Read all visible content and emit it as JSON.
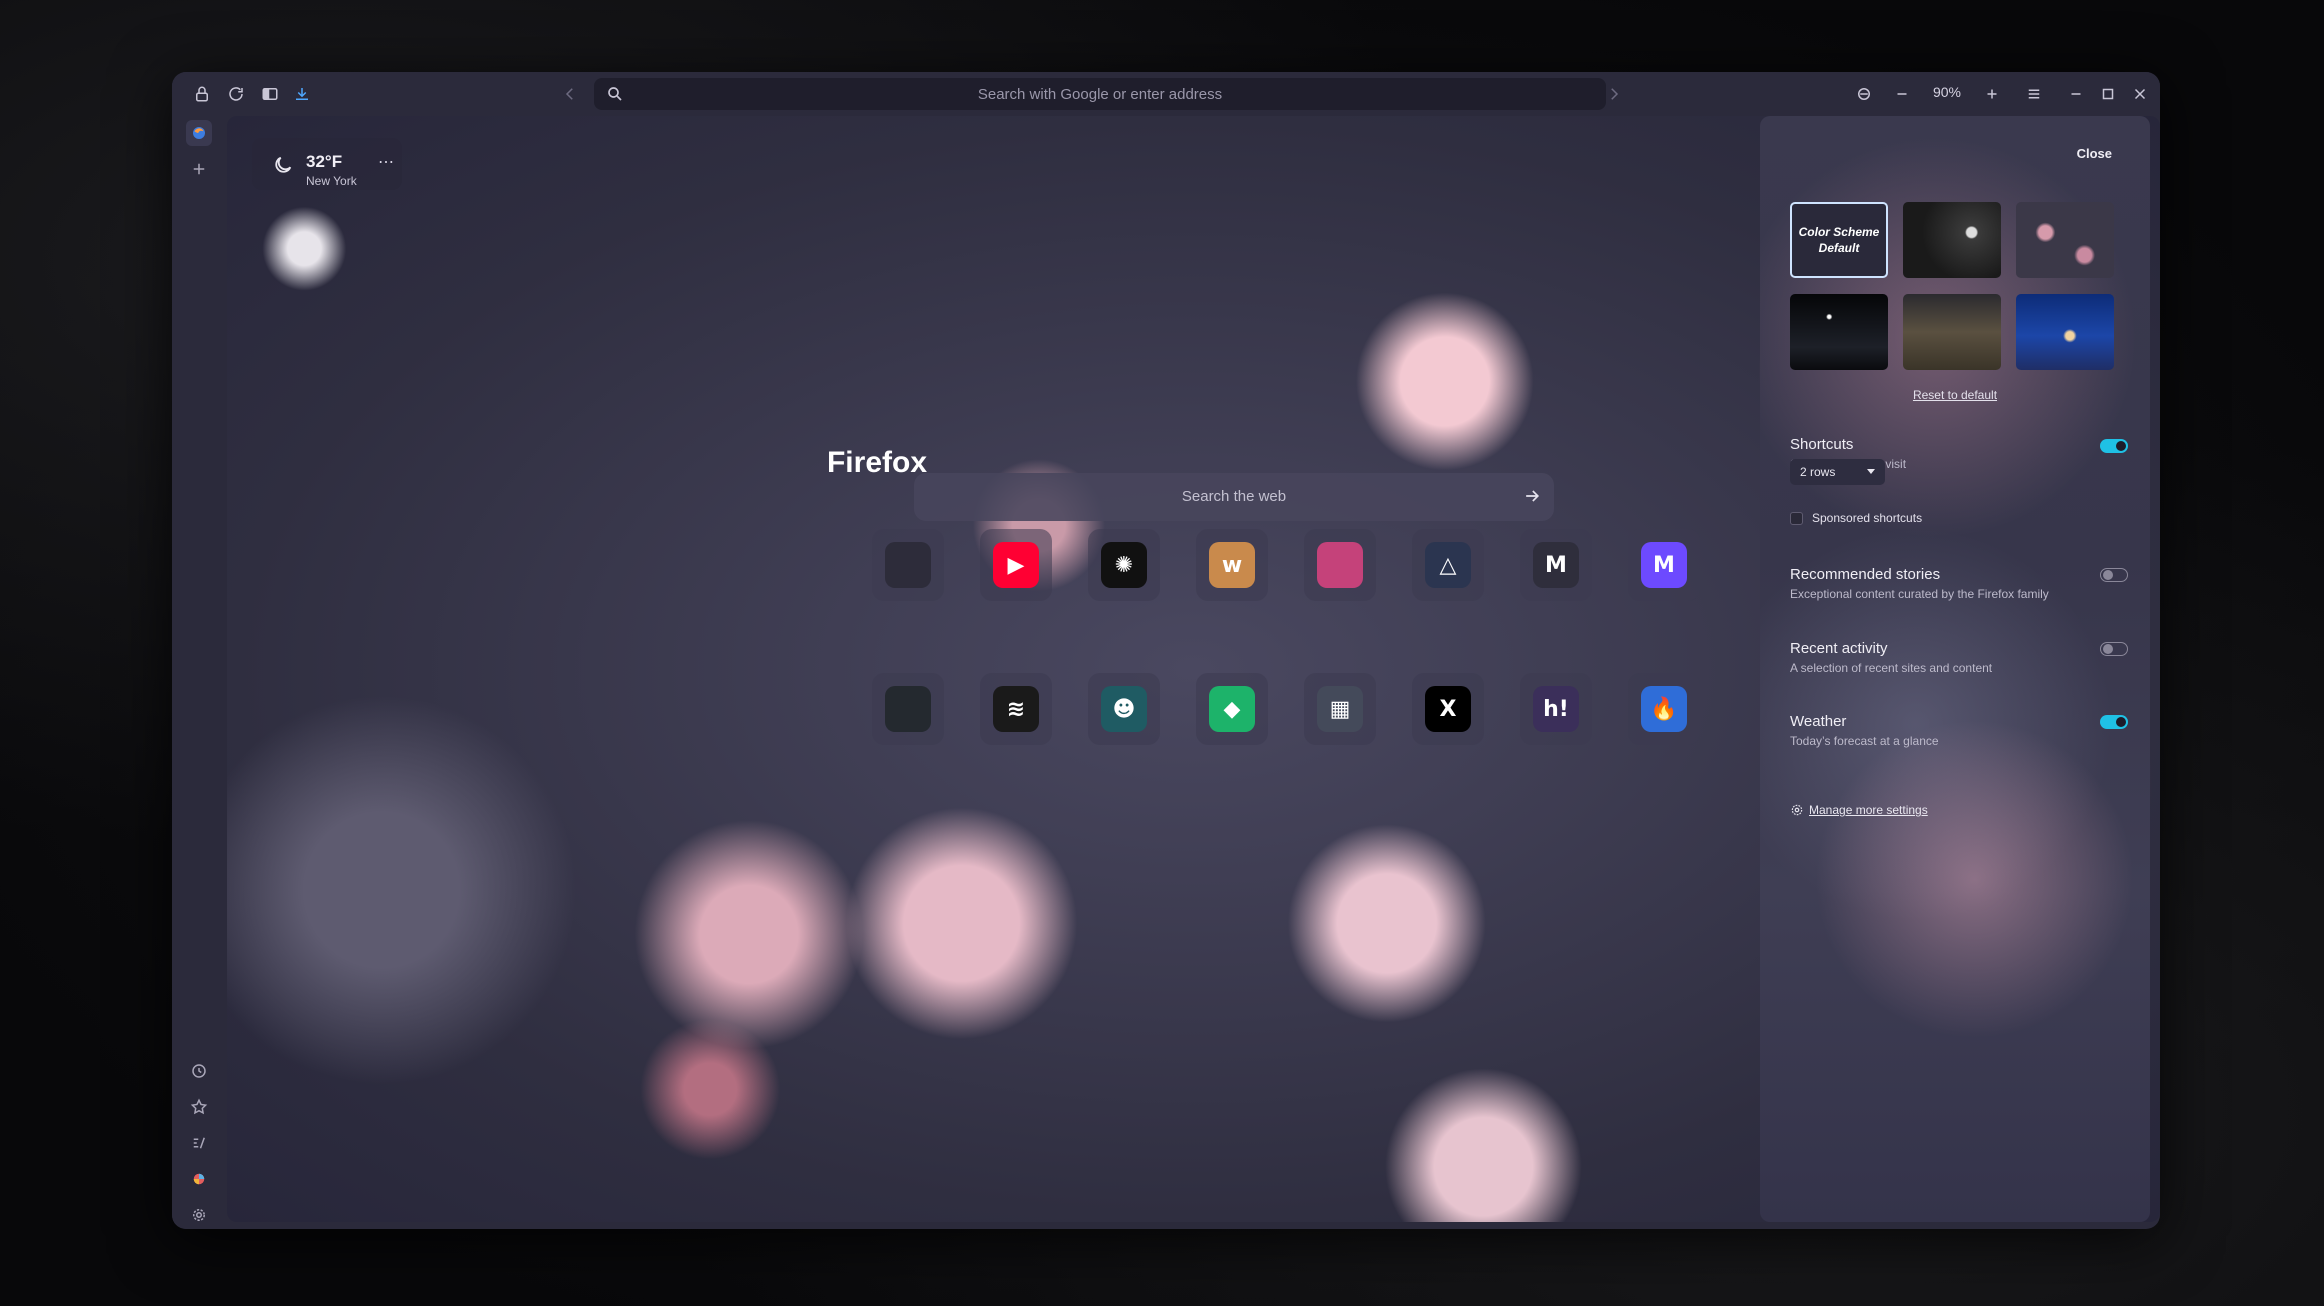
{
  "toolbar": {
    "url_placeholder": "Search with Google or enter address",
    "zoom": "90%"
  },
  "weather": {
    "temperature": "32°F",
    "location": "New York",
    "menu": "⋯"
  },
  "newtab": {
    "brand": "Firefox",
    "search_placeholder": "Search the web"
  },
  "shortcuts": [
    {
      "icon": "github-icon",
      "glyph": "",
      "bg": "#2d2c3a"
    },
    {
      "icon": "youtube-icon",
      "glyph": "▶",
      "bg": "#ff0033"
    },
    {
      "icon": "chatgpt-icon",
      "glyph": "✺",
      "bg": "#111111"
    },
    {
      "icon": "wordtune-icon",
      "glyph": "w",
      "bg": "#c98a4c"
    },
    {
      "icon": "pink-gradient-icon",
      "glyph": "",
      "bg": "#c5427a"
    },
    {
      "icon": "mountain-icon",
      "glyph": "△",
      "bg": "#2b3550"
    },
    {
      "icon": "gmail-icon",
      "glyph": "M",
      "bg": "#2f2e3c"
    },
    {
      "icon": "proton-mail-icon",
      "glyph": "M",
      "bg": "#6d4aff"
    },
    {
      "icon": "github-icon",
      "glyph": "",
      "bg": "#24292f"
    },
    {
      "icon": "spotify-icon",
      "glyph": "≋",
      "bg": "#1a1a1a"
    },
    {
      "icon": "green-mascot-icon",
      "glyph": "☻",
      "bg": "#1f5b63"
    },
    {
      "icon": "tag-icon",
      "glyph": "◆",
      "bg": "#1db36a"
    },
    {
      "icon": "server-icon",
      "glyph": "▦",
      "bg": "#444a5a"
    },
    {
      "icon": "x-icon",
      "glyph": "X",
      "bg": "#000000"
    },
    {
      "icon": "hashnode-icon",
      "glyph": "h!",
      "bg": "#3b2f5a"
    },
    {
      "icon": "flame-icon",
      "glyph": "🔥",
      "bg": "#2f6dd8"
    }
  ],
  "panel": {
    "close": "Close",
    "default_wallpaper": "Color Scheme Default",
    "reset": "Reset to default",
    "shortcuts": {
      "title": "Shortcuts",
      "subtitle": "Sites you save or visit",
      "rows": "2 rows",
      "sponsored": "Sponsored shortcuts",
      "enabled": true
    },
    "recommended": {
      "title": "Recommended stories",
      "subtitle": "Exceptional content curated by the Firefox family",
      "enabled": false
    },
    "recent": {
      "title": "Recent activity",
      "subtitle": "A selection of recent sites and content",
      "enabled": false
    },
    "weather": {
      "title": "Weather",
      "subtitle": "Today’s forecast at a glance",
      "enabled": true
    },
    "manage": "Manage more settings"
  }
}
